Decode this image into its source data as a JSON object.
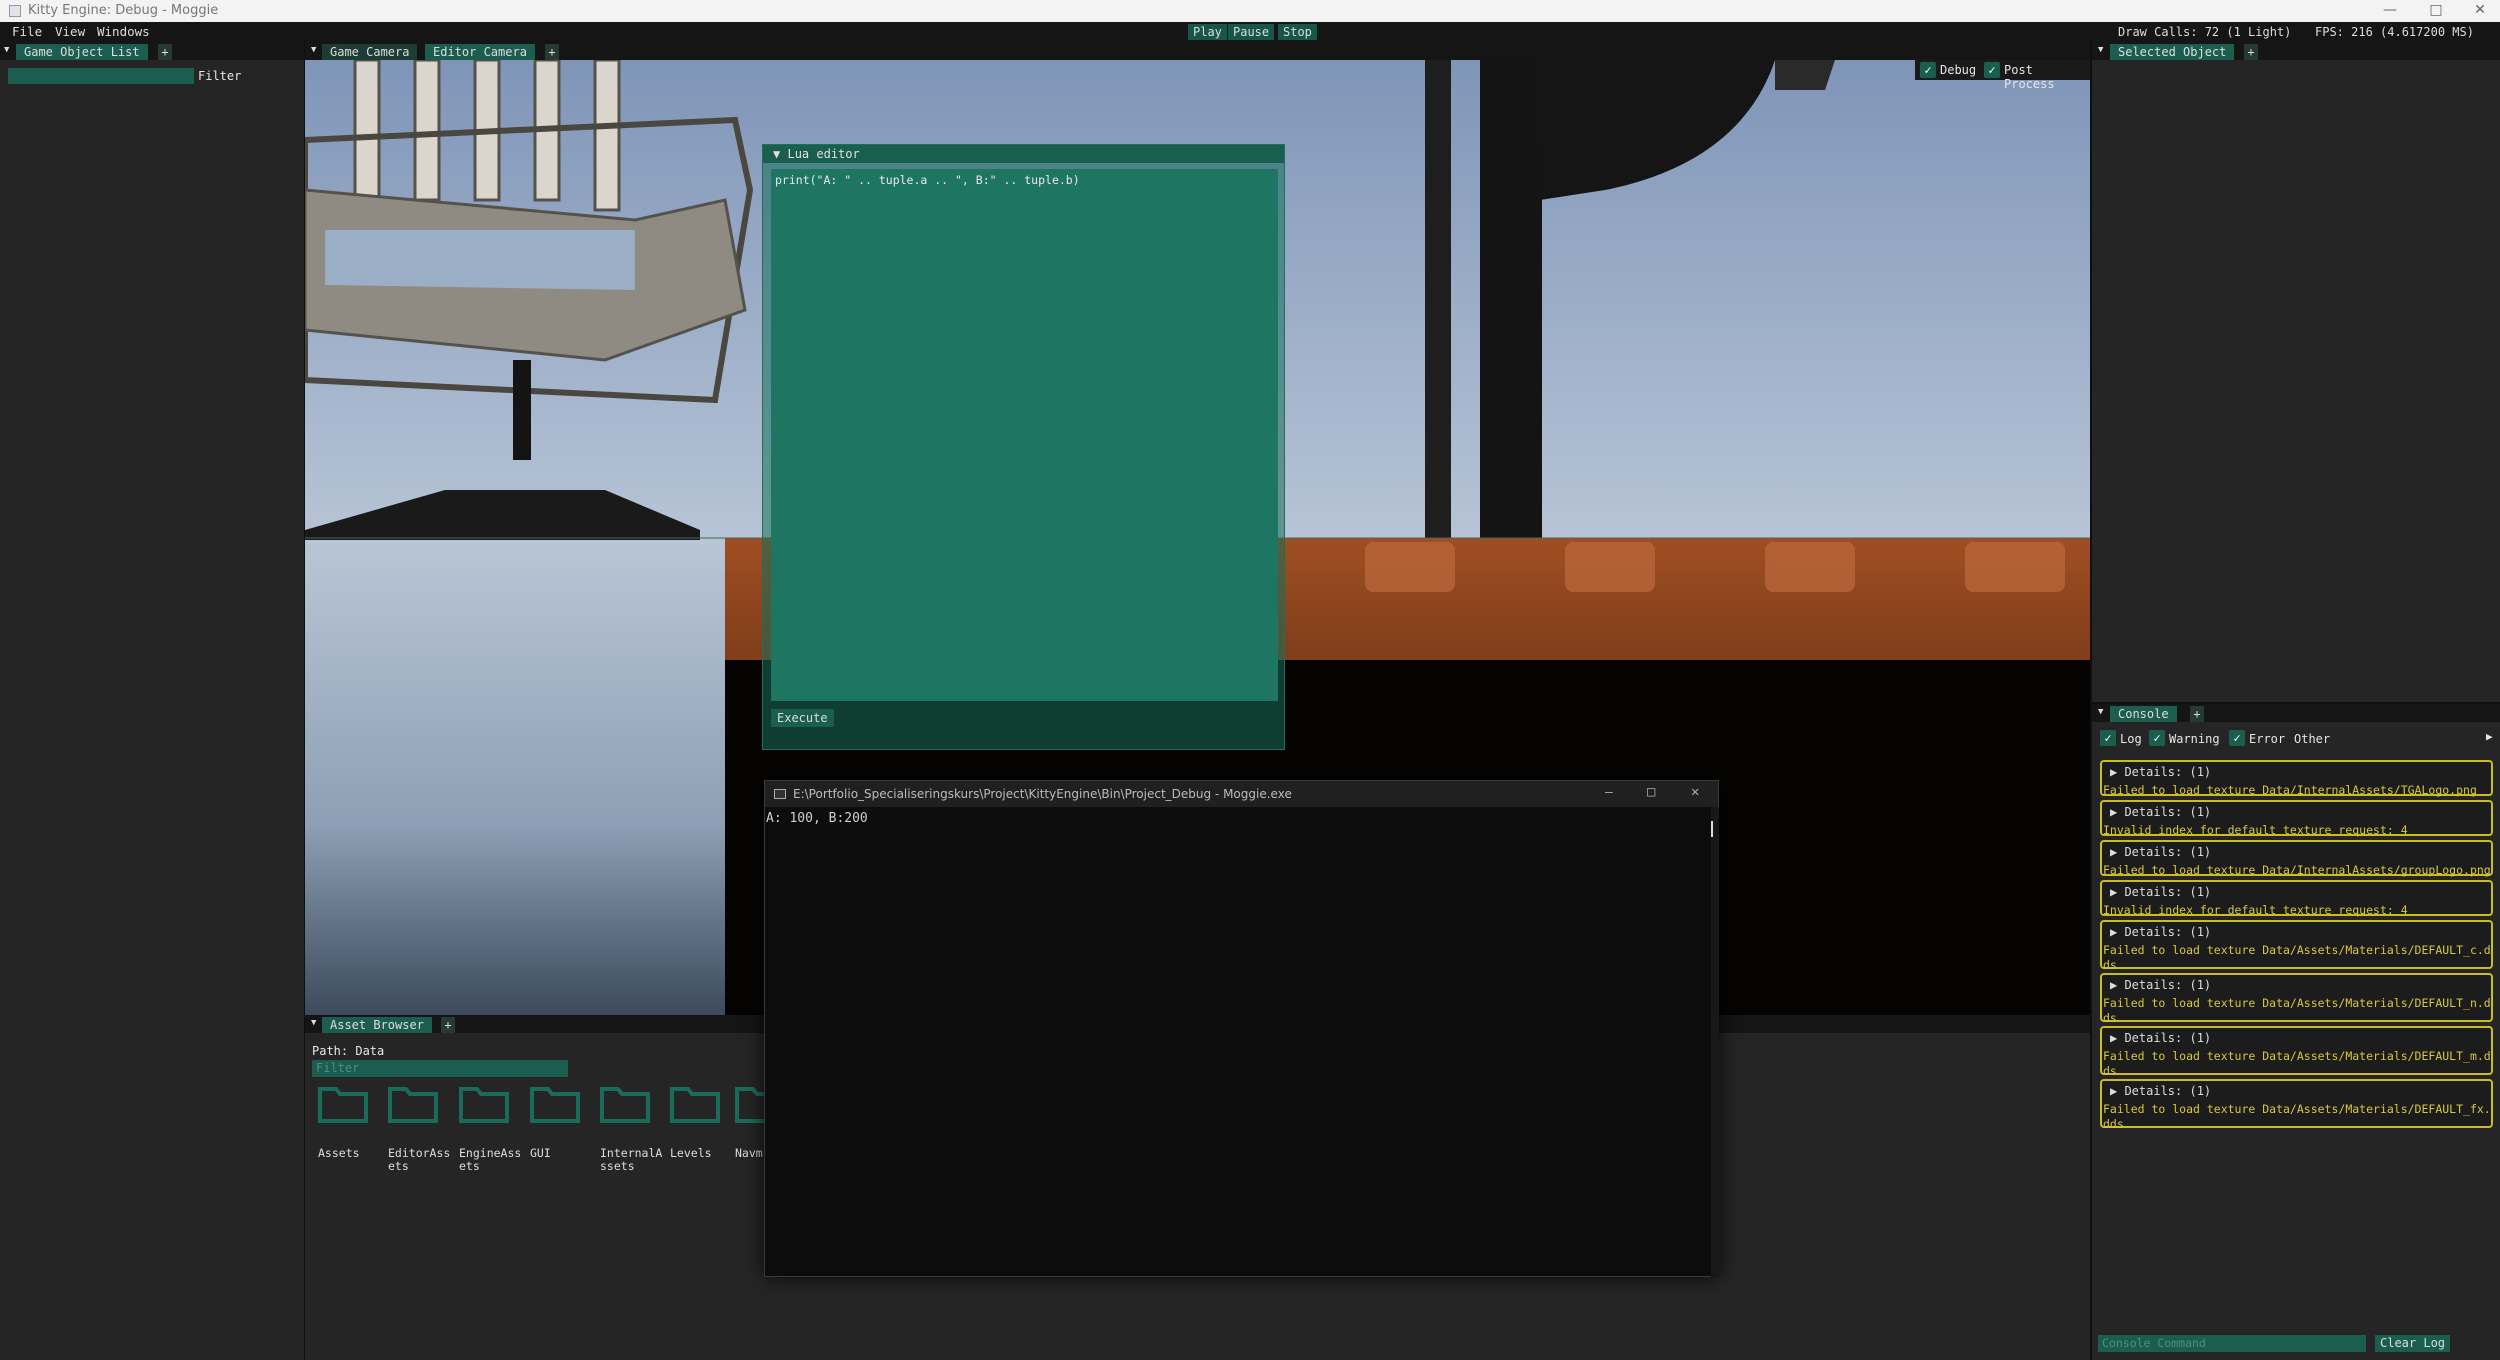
{
  "window": {
    "title": "Kitty Engine: Debug - Moggie"
  },
  "menu": {
    "file": "File",
    "view": "View",
    "windows": "Windows"
  },
  "toolbar": {
    "play": "Play",
    "pause": "Pause",
    "stop": "Stop"
  },
  "stats": {
    "draw_calls": "Draw Calls: 72 (1 Light)",
    "fps": "FPS: 216 (4.617200 MS)"
  },
  "left_panel": {
    "tab": "Game Object List",
    "filter_label": "Filter"
  },
  "viewport": {
    "tabs": [
      "Game Camera",
      "Editor Camera"
    ],
    "debug_label": "Debug",
    "post_process_label": "Post Process"
  },
  "lua_editor": {
    "title": "Lua editor",
    "code": "print(\"A: \" .. tuple.a .. \", B:\" .. tuple.b)",
    "execute": "Execute"
  },
  "cmd_window": {
    "title": "E:\\Portfolio_Specialiseringskurs\\Project\\KittyEngine\\Bin\\Project_Debug - Moggie.exe",
    "output": "A: 100, B:200"
  },
  "asset_browser": {
    "tab": "Asset Browser",
    "path": "Path: Data",
    "filter_placeholder": "Filter",
    "folders": [
      {
        "label": "Assets"
      },
      {
        "label": "EditorAssets"
      },
      {
        "label": "EngineAssets"
      },
      {
        "label": "GUI"
      },
      {
        "label": "InternalAssets"
      },
      {
        "label": "Levels"
      },
      {
        "label": "Navm"
      }
    ]
  },
  "selected_object": {
    "tab": "Selected Object"
  },
  "console": {
    "tab": "Console",
    "filters": {
      "log": "Log",
      "warning": "Warning",
      "error": "Error",
      "other": "Other"
    },
    "entries": [
      {
        "details": "Details: (1)",
        "message": "Failed to load texture Data/InternalAssets/TGALogo.png"
      },
      {
        "details": "Details: (1)",
        "message": "Invalid index for default texture request: 4"
      },
      {
        "details": "Details: (1)",
        "message": "Failed to load texture Data/InternalAssets/groupLogo.png"
      },
      {
        "details": "Details: (1)",
        "message": "Invalid index for default texture request: 4"
      },
      {
        "details": "Details: (1)",
        "message": "Failed to load texture Data/Assets/Materials/DEFAULT_c.dds"
      },
      {
        "details": "Details: (1)",
        "message": "Failed to load texture Data/Assets/Materials/DEFAULT_n.dds"
      },
      {
        "details": "Details: (1)",
        "message": "Failed to load texture Data/Assets/Materials/DEFAULT_m.dds"
      },
      {
        "details": "Details: (1)",
        "message": "Failed to load texture Data/Assets/Materials/DEFAULT_fx.dds"
      }
    ],
    "command_placeholder": "Console Command",
    "clear_log": "Clear Log"
  },
  "colors": {
    "accent": "#1b5e50",
    "warning_border": "#c8be22",
    "warning_text": "#d8c83c"
  }
}
